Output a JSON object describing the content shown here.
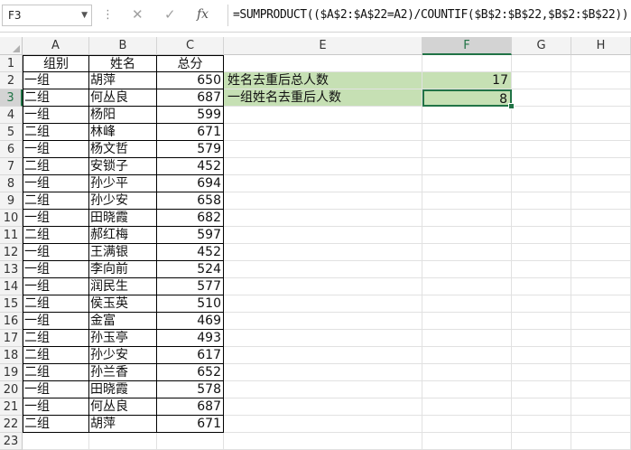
{
  "formula_bar": {
    "name_box": "F3",
    "cancel_symbol": "✕",
    "enter_symbol": "✓",
    "fx_label": "fx",
    "formula": "=SUMPRODUCT(($A$2:$A$22=A2)/COUNTIF($B$2:$B$22,$B$2:$B$22))"
  },
  "columns": [
    "A",
    "B",
    "C",
    "",
    "E",
    "F",
    "G",
    "H"
  ],
  "selected_column": "F",
  "headers": {
    "a": "组别",
    "b": "姓名",
    "c": "总分"
  },
  "rows": [
    {
      "n": "1"
    },
    {
      "n": "2",
      "a": "一组",
      "b": "胡萍",
      "c": "650",
      "e": "姓名去重后总人数",
      "f": "17"
    },
    {
      "n": "3",
      "a": "二组",
      "b": "何丛良",
      "c": "687",
      "e": "一组姓名去重后人数",
      "f": "8"
    },
    {
      "n": "4",
      "a": "一组",
      "b": "杨阳",
      "c": "599"
    },
    {
      "n": "5",
      "a": "二组",
      "b": "林峰",
      "c": "671"
    },
    {
      "n": "6",
      "a": "一组",
      "b": "杨文哲",
      "c": "579"
    },
    {
      "n": "7",
      "a": "二组",
      "b": "安锁子",
      "c": "452"
    },
    {
      "n": "8",
      "a": "一组",
      "b": "孙少平",
      "c": "694"
    },
    {
      "n": "9",
      "a": "二组",
      "b": "孙少安",
      "c": "658"
    },
    {
      "n": "10",
      "a": "一组",
      "b": "田晓霞",
      "c": "682"
    },
    {
      "n": "11",
      "a": "二组",
      "b": "郝红梅",
      "c": "597"
    },
    {
      "n": "12",
      "a": "一组",
      "b": "王满银",
      "c": "452"
    },
    {
      "n": "13",
      "a": "一组",
      "b": "李向前",
      "c": "524"
    },
    {
      "n": "14",
      "a": "一组",
      "b": "润民生",
      "c": "577"
    },
    {
      "n": "15",
      "a": "二组",
      "b": "侯玉英",
      "c": "510"
    },
    {
      "n": "16",
      "a": "一组",
      "b": "金富",
      "c": "469"
    },
    {
      "n": "17",
      "a": "二组",
      "b": "孙玉亭",
      "c": "493"
    },
    {
      "n": "18",
      "a": "二组",
      "b": "孙少安",
      "c": "617"
    },
    {
      "n": "19",
      "a": "二组",
      "b": "孙兰香",
      "c": "652"
    },
    {
      "n": "20",
      "a": "一组",
      "b": "田晓霞",
      "c": "578"
    },
    {
      "n": "21",
      "a": "一组",
      "b": "何丛良",
      "c": "687"
    },
    {
      "n": "22",
      "a": "二组",
      "b": "胡萍",
      "c": "671"
    },
    {
      "n": "23"
    }
  ],
  "colors": {
    "accent": "#217346",
    "highlight": "#c6e0b4"
  }
}
